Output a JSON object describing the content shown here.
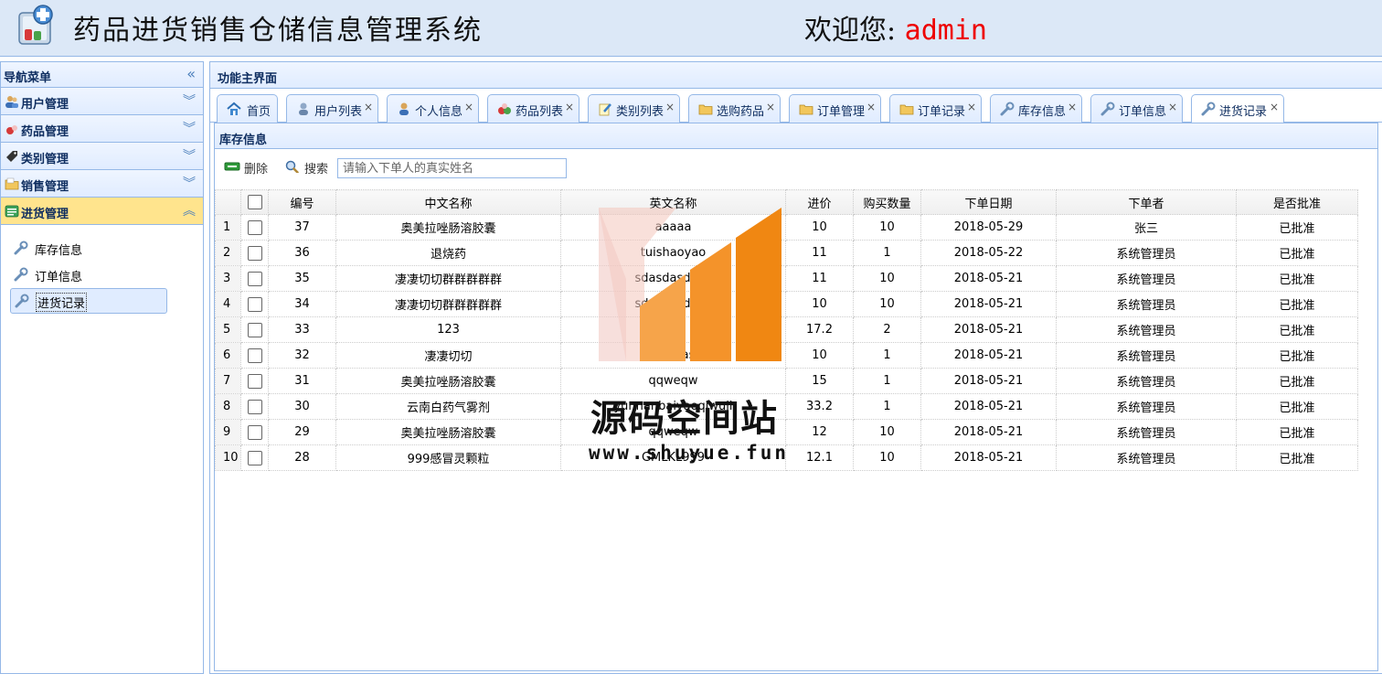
{
  "header": {
    "app_title": "药品进货销售仓储信息管理系统",
    "welcome_label": "欢迎您:",
    "welcome_user": "admin"
  },
  "sidebar": {
    "title": "导航菜单",
    "items": [
      {
        "label": "用户管理",
        "icon": "user-group-icon",
        "expanded": false
      },
      {
        "label": "药品管理",
        "icon": "pills-icon",
        "expanded": false
      },
      {
        "label": "类别管理",
        "icon": "tag-icon",
        "expanded": false
      },
      {
        "label": "销售管理",
        "icon": "folder-icon",
        "expanded": false
      },
      {
        "label": "进货管理",
        "icon": "list-icon",
        "expanded": true
      }
    ],
    "sub_items": [
      {
        "label": "库存信息",
        "icon": "wrench-icon"
      },
      {
        "label": "订单信息",
        "icon": "wrench-icon"
      },
      {
        "label": "进货记录",
        "icon": "wrench-icon",
        "selected": true
      }
    ]
  },
  "center": {
    "title": "功能主界面",
    "tabs": [
      {
        "label": "首页",
        "icon": "home-icon",
        "closable": false
      },
      {
        "label": "用户列表",
        "icon": "users-icon",
        "closable": true
      },
      {
        "label": "个人信息",
        "icon": "person-icon",
        "closable": true
      },
      {
        "label": "药品列表",
        "icon": "pills-icon",
        "closable": true
      },
      {
        "label": "类别列表",
        "icon": "edit-icon",
        "closable": true
      },
      {
        "label": "选购药品",
        "icon": "folder-icon",
        "closable": true
      },
      {
        "label": "订单管理",
        "icon": "folder-icon",
        "closable": true
      },
      {
        "label": "订单记录",
        "icon": "folder-icon",
        "closable": true
      },
      {
        "label": "库存信息",
        "icon": "wrench-icon",
        "closable": true
      },
      {
        "label": "订单信息",
        "icon": "wrench-icon",
        "closable": true
      },
      {
        "label": "进货记录",
        "icon": "wrench-icon",
        "closable": true,
        "active": true
      }
    ],
    "close_glyph": "×"
  },
  "grid_panel": {
    "title": "库存信息",
    "toolbar": {
      "delete_label": "删除",
      "search_label": "搜索",
      "search_placeholder": "请输入下单人的真实姓名"
    },
    "columns": [
      "编号",
      "中文名称",
      "英文名称",
      "进价",
      "购买数量",
      "下单日期",
      "下单者",
      "是否批准"
    ],
    "rows": [
      [
        "1",
        "37",
        "奥美拉唑肠溶胶囊",
        "aaaaa",
        "10",
        "10",
        "2018-05-29",
        "张三",
        "已批准"
      ],
      [
        "2",
        "36",
        "退烧药",
        "tuishaoyao",
        "11",
        "1",
        "2018-05-22",
        "系统管理员",
        "已批准"
      ],
      [
        "3",
        "35",
        "凄凄切切群群群群群",
        "sdasdasdasd",
        "11",
        "10",
        "2018-05-21",
        "系统管理员",
        "已批准"
      ],
      [
        "4",
        "34",
        "凄凄切切群群群群群",
        "sdasdasdasd",
        "10",
        "10",
        "2018-05-21",
        "系统管理员",
        "已批准"
      ],
      [
        "5",
        "33",
        "123",
        "123",
        "17.2",
        "2",
        "2018-05-21",
        "系统管理员",
        "已批准"
      ],
      [
        "6",
        "32",
        "凄凄切切",
        "qqqqas",
        "10",
        "1",
        "2018-05-21",
        "系统管理员",
        "已批准"
      ],
      [
        "7",
        "31",
        "奥美拉唑肠溶胶囊",
        "qqweqw",
        "15",
        "1",
        "2018-05-21",
        "系统管理员",
        "已批准"
      ],
      [
        "8",
        "30",
        "云南白药气雾剂",
        "yunnanbaiyaoqiwuji",
        "33.2",
        "1",
        "2018-05-21",
        "系统管理员",
        "已批准"
      ],
      [
        "9",
        "29",
        "奥美拉唑肠溶胶囊",
        "qqweqw",
        "12",
        "10",
        "2018-05-21",
        "系统管理员",
        "已批准"
      ],
      [
        "10",
        "28",
        "999感冒灵颗粒",
        "GMLKL999",
        "12.1",
        "10",
        "2018-05-21",
        "系统管理员",
        "已批准"
      ]
    ]
  },
  "watermark": {
    "name": "源码空间站",
    "url": "www.shuyue.fun"
  }
}
